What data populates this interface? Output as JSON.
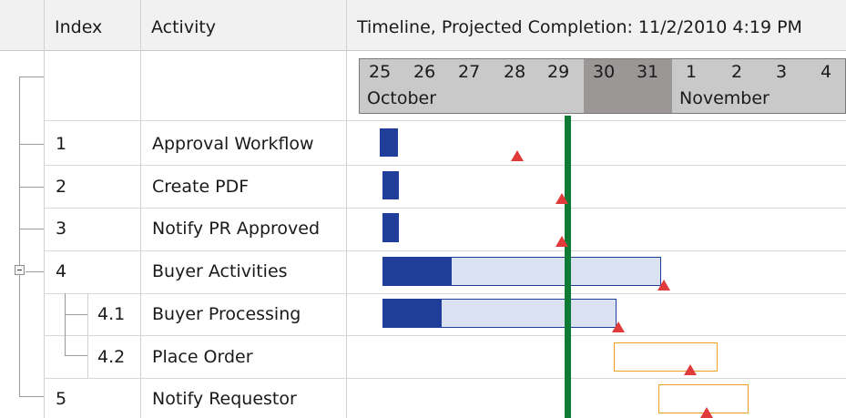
{
  "header": {
    "index_label": "Index",
    "activity_label": "Activity",
    "timeline_label": "Timeline, Projected Completion: 11/2/2010 4:19 PM"
  },
  "timeline": {
    "days": [
      "25",
      "26",
      "27",
      "28",
      "29",
      "30",
      "31",
      "1",
      "2",
      "3",
      "4"
    ],
    "months": [
      "October",
      "November"
    ],
    "weekend_days": [
      "30",
      "31"
    ]
  },
  "rows": [
    {
      "index": "1",
      "activity": "Approval Workflow"
    },
    {
      "index": "2",
      "activity": "Create PDF"
    },
    {
      "index": "3",
      "activity": "Notify PR Approved"
    },
    {
      "index": "4",
      "activity": "Buyer Activities"
    },
    {
      "index": "4.1",
      "activity": "Buyer Processing"
    },
    {
      "index": "4.2",
      "activity": "Place Order"
    },
    {
      "index": "5",
      "activity": "Notify Requestor"
    }
  ],
  "colors": {
    "progress_fill": "#1f3d99",
    "remaining_fill": "#dae2f2",
    "pending_border": "#f0a020",
    "milestone": "#e03a3a",
    "today_line": "#0d7a35",
    "weekend_band": "#9b9797"
  }
}
